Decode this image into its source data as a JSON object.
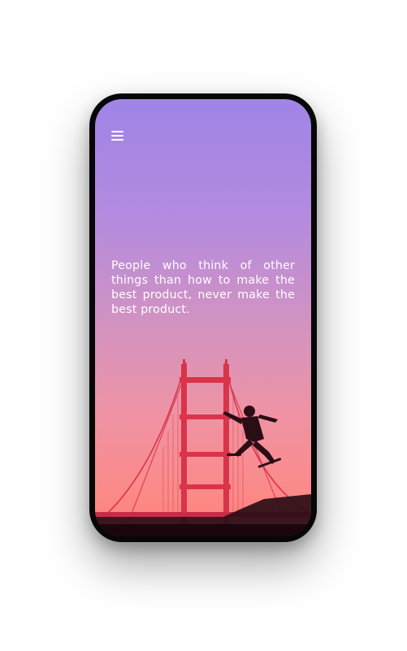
{
  "app": {
    "menu_icon": "hamburger-menu-icon",
    "quote": "People who think of other things than how to make the best product, never make the best product.",
    "background_gradient": [
      "#9f84e6",
      "#d393c0",
      "#ff8079"
    ],
    "bridge_color": "#d9344a",
    "silhouette_color": "#2b0d16",
    "illustration": {
      "subject": "skateboarder-silhouette-icon",
      "landmark": "suspension-bridge-icon"
    }
  }
}
